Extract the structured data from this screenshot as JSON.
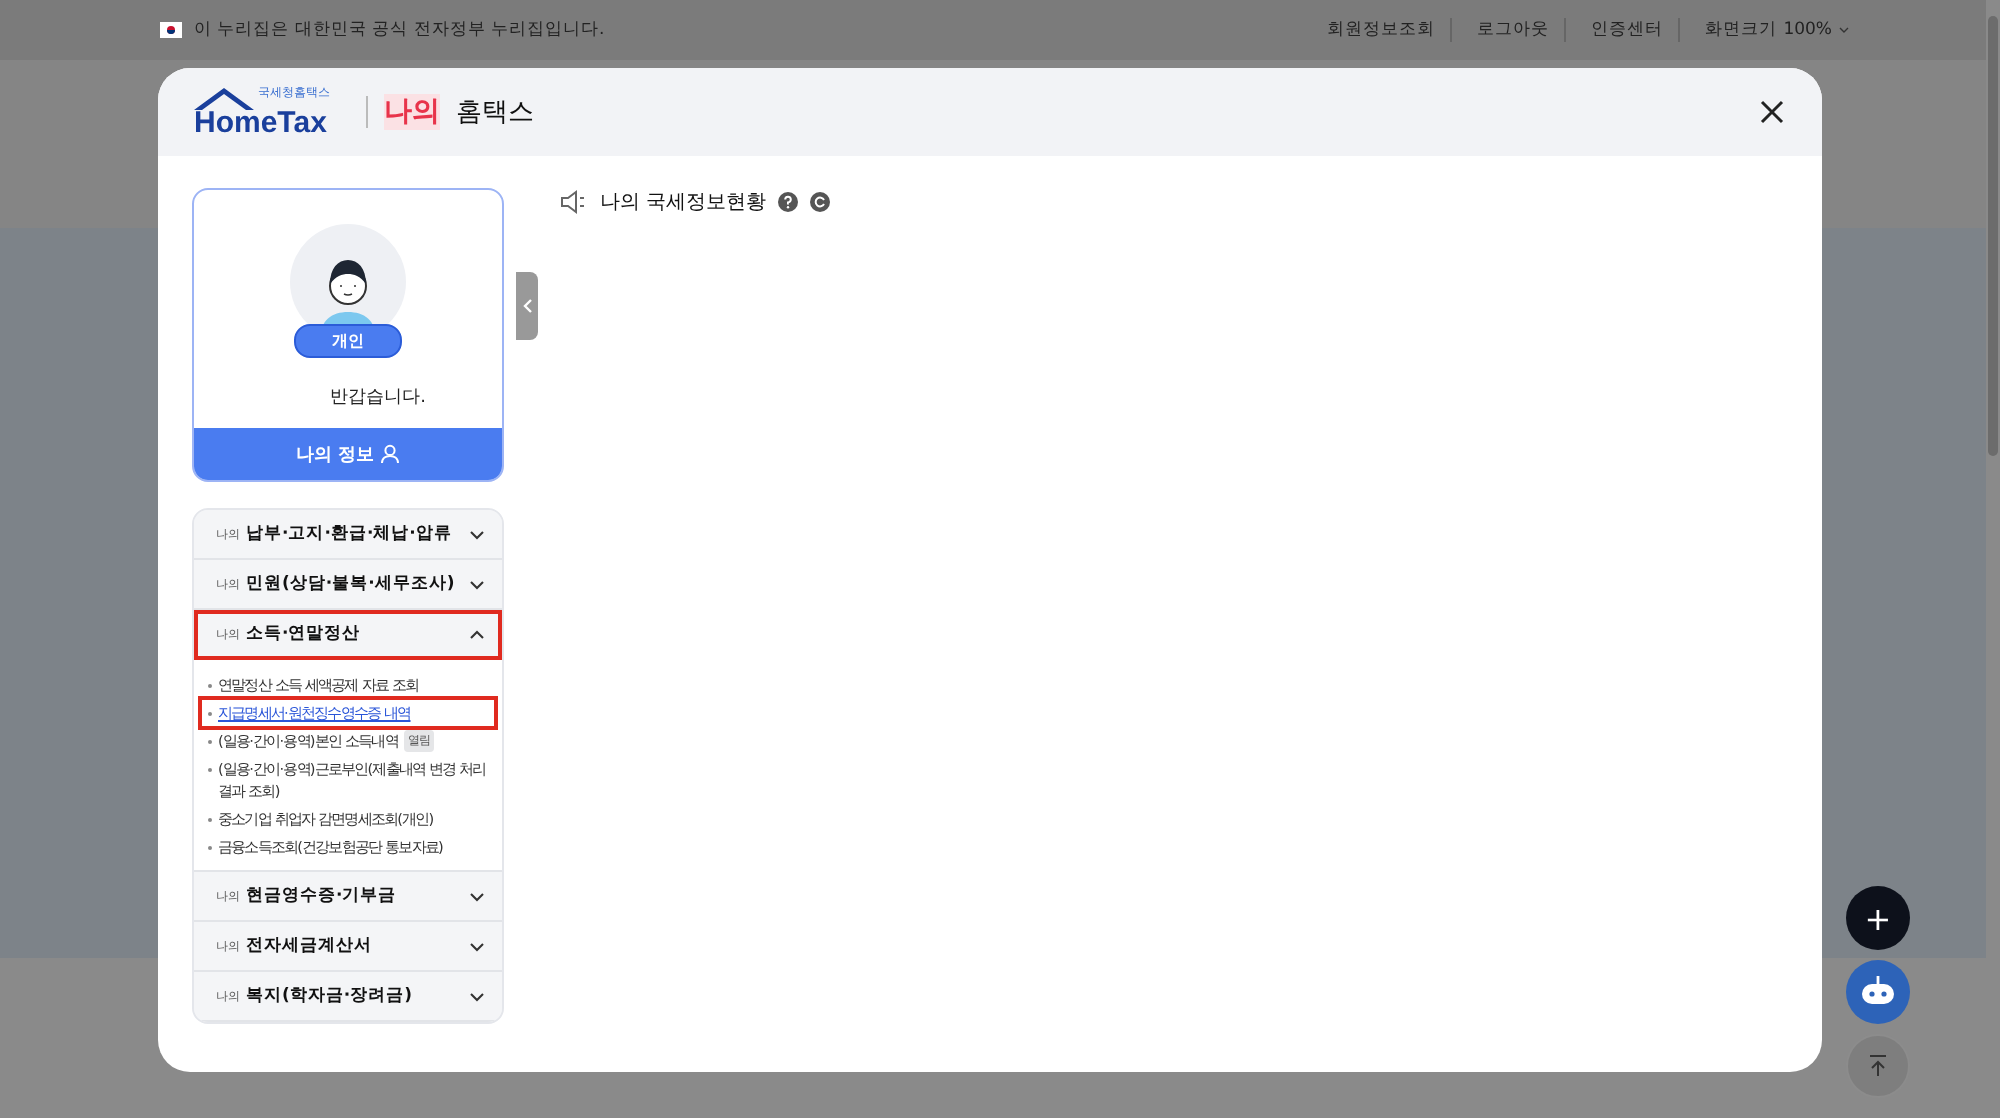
{
  "top_bar": {
    "notice": "이 누리집은 대한민국 공식 전자정부 누리집입니다.",
    "links": [
      "회원정보조회",
      "로그아웃",
      "인증센터"
    ],
    "zoom_label": "화면크기",
    "zoom_value": "100%"
  },
  "modal": {
    "logo_small": "국세청홈택스",
    "logo_text": "HomeTax",
    "title_accent": "나의",
    "title": "홈택스",
    "profile": {
      "badge": "개인",
      "greeting": "반갑습니다.",
      "button": "나의 정보"
    },
    "menu": [
      {
        "prefix": "나의",
        "title": "납부·고지·환급·체납·압류",
        "expanded": false,
        "highlighted": false
      },
      {
        "prefix": "나의",
        "title": "민원(상담·불복·세무조사)",
        "expanded": false,
        "highlighted": false
      },
      {
        "prefix": "나의",
        "title": "소득·연말정산",
        "expanded": true,
        "highlighted": true,
        "children": [
          {
            "label": "연말정산 소득 세액공제 자료 조회",
            "selected": false
          },
          {
            "label": "지급명세서·원천징수영수증 내역",
            "selected": true
          },
          {
            "label": "(일용·간이·용역)본인 소득내역",
            "badge": "열림",
            "selected": false
          },
          {
            "label": "(일용·간이·용역)근로부인(제출내역 변경 처리결과 조회)",
            "selected": false
          },
          {
            "label": "중소기업 취업자 감면명세조회(개인)",
            "selected": false
          },
          {
            "label": "금융소득조회(건강보험공단 통보자료)",
            "selected": false
          }
        ]
      },
      {
        "prefix": "나의",
        "title": "현금영수증·기부금",
        "expanded": false,
        "highlighted": false
      },
      {
        "prefix": "나의",
        "title": "전자세금계산서",
        "expanded": false,
        "highlighted": false
      },
      {
        "prefix": "나의",
        "title": "복지(학자금·장려금)",
        "expanded": false,
        "highlighted": false
      }
    ],
    "section_title": "나의 국세정보현황"
  },
  "floating": {
    "add": "+"
  }
}
